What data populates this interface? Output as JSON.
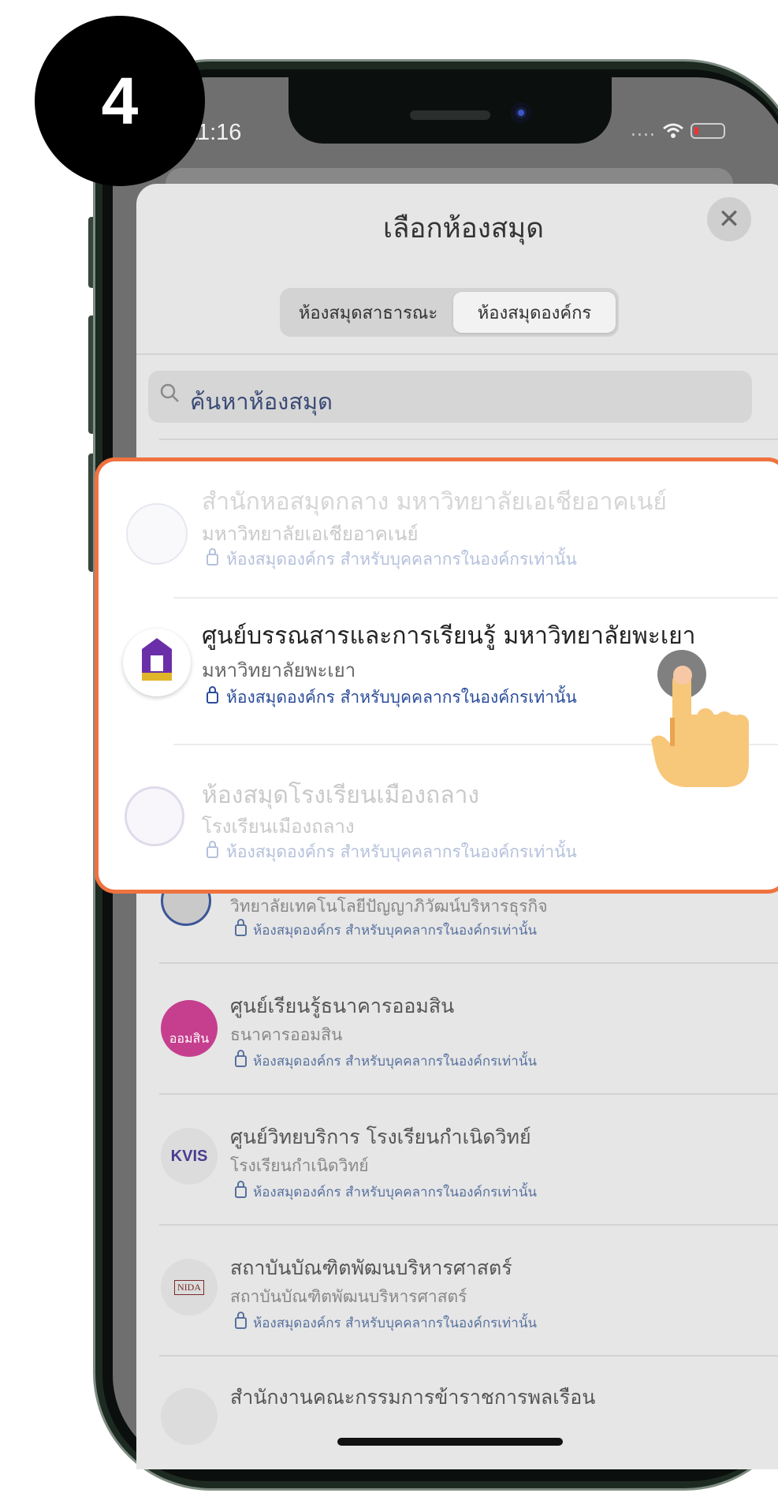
{
  "step": {
    "number": "4"
  },
  "status_bar": {
    "time": "11:16",
    "signal": "....",
    "wifi_icon": "wifi-icon",
    "battery_icon": "battery-icon"
  },
  "sheet": {
    "title": "เลือกห้องสมุด",
    "close_icon": "close-icon",
    "tabs": [
      {
        "label": "ห้องสมุดสาธารณะ",
        "selected": false
      },
      {
        "label": "ห้องสมุดองค์กร",
        "selected": true
      }
    ],
    "search": {
      "placeholder": "ค้นหาห้องสมุด"
    }
  },
  "highlight": {
    "border_color": "#f0723f",
    "items": [
      {
        "title": "สำนักหอสมุดกลาง มหาวิทยาลัยเอเชียอาคเนย์",
        "subtitle": "มหาวิทยาลัยเอเชียอาคเนย์",
        "access": "ห้องสมุดองค์กร สำหรับบุคคลากรในองค์กรเท่านั้น",
        "active": false
      },
      {
        "title": "ศูนย์บรรณสารและการเรียนรู้ มหาวิทยาลัยพะเยา",
        "subtitle": "มหาวิทยาลัยพะเยา",
        "access": "ห้องสมุดองค์กร สำหรับบุคคลากรในองค์กรเท่านั้น",
        "active": true
      },
      {
        "title": "ห้องสมุดโรงเรียนเมืองถลาง",
        "subtitle": "โรงเรียนเมืองถลาง",
        "access": "ห้องสมุดองค์กร สำหรับบุคคลากรในองค์กรเท่านั้น",
        "active": false
      }
    ]
  },
  "list": {
    "partial_top": {
      "subtitle": "วิทยาลัยเทคโนโลยีปัญญาภิวัฒน์บริหารธุรกิจ",
      "access": "ห้องสมุดองค์กร สำหรับบุคคลากรในองค์กรเท่านั้น"
    },
    "items": [
      {
        "title": "ศูนย์เรียนรู้ธนาคารออมสิน",
        "subtitle": "ธนาคารออมสิน",
        "access": "ห้องสมุดองค์กร สำหรับบุคคลากรในองค์กรเท่านั้น",
        "logo_text": "ออมสิน"
      },
      {
        "title": "ศูนย์วิทยบริการ โรงเรียนกำเนิดวิทย์",
        "subtitle": "โรงเรียนกำเนิดวิทย์",
        "access": "ห้องสมุดองค์กร สำหรับบุคคลากรในองค์กรเท่านั้น",
        "logo_text": "KVIS"
      },
      {
        "title": "สถาบันบัณฑิตพัฒนบริหารศาสตร์",
        "subtitle": "สถาบันบัณฑิตพัฒนบริหารศาสตร์",
        "access": "ห้องสมุดองค์กร สำหรับบุคคลากรในองค์กรเท่านั้น",
        "logo_text": "NIDA"
      }
    ],
    "partial_bottom": {
      "title": "สำนักงานคณะกรรมการข้าราชการพลเรือน"
    }
  },
  "gesture": {
    "icon": "tap-hand-icon"
  }
}
